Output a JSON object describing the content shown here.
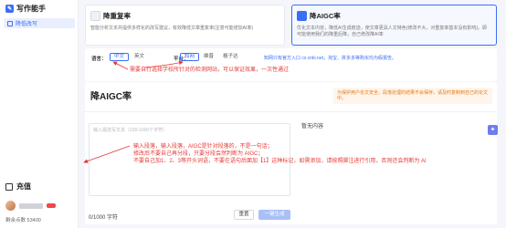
{
  "sidebar": {
    "app_title": "写作能手",
    "nav_item": "降低改写",
    "recharge": "充值",
    "points": "剩余点数 53400"
  },
  "cards": [
    {
      "title": "降重复率",
      "desc": "智能分析文本并提供多样化的改写建议，有效降低文章重复率(注意可能增加AI率)",
      "icon": "rewrite-icon"
    },
    {
      "title": "降AIGC率",
      "desc": "优化文本内容，降低AI生成痕迹，使文章更具人文特色(修改不大，对重复率基本没有影响)。即可能使用我们的降重后降，自己修改降AI率",
      "icon": "ai-icon"
    }
  ],
  "settings": {
    "lang_label": "语言：",
    "lang_options": [
      "中文",
      "英文"
    ],
    "platform_label": "平台：",
    "platform_options": [
      "知网",
      "维普",
      "格子达"
    ],
    "notice": "知网只有官方入口 cx.cnki.net，淘宝、拼多多等购买均为假报告。"
  },
  "annotations": {
    "platform_tip": "需要自行选择学校所针对的检测网站，可以保证效果，一次性通过",
    "input_tip_1": "输入段落，输入段落，AIGC是针对段落的，不是一句话；",
    "input_tip_2": "修改后不要自己再分段，只要分段会然判断为 AIGC；",
    "input_tip_3": "不要自己加1、2、3等开头词语，不要在语句后面加【1】这种标记，如需添加，请按照脚注进行引用，否则还会判断为 AI"
  },
  "main": {
    "title": "降AIGC率",
    "warning": "为保护用户论文安全，段落处理的结果不会保存，请及时复制到自己的论文中。",
    "placeholder": "输入需改写文本（100-1000个字符）",
    "result_label": "暂无内容",
    "counter": "0/1000 字符",
    "clear_button": "重置",
    "generate_button": "一键生成"
  },
  "colors": {
    "accent": "#3b6ef6",
    "annotation": "#e53935"
  }
}
